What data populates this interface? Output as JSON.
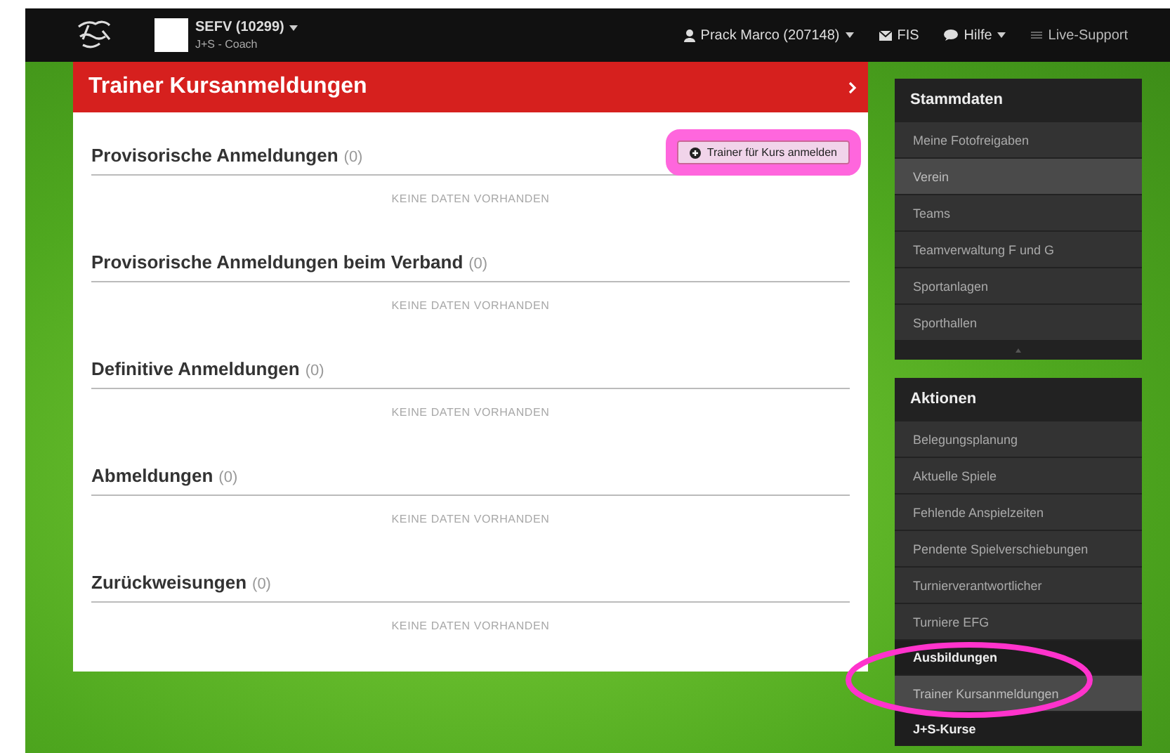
{
  "topbar": {
    "org_name": "SEFV (10299)",
    "org_role": "J+S - Coach",
    "user": "Prack Marco (207148)",
    "links": [
      {
        "kind": "mail",
        "label": "FIS",
        "dropdown": false
      },
      {
        "kind": "chat",
        "label": "Hilfe",
        "dropdown": true
      },
      {
        "kind": "support",
        "label": "Live-Support",
        "dropdown": false
      }
    ]
  },
  "panel": {
    "title": "Trainer Kursanmeldungen",
    "action_button": "Trainer für Kurs anmelden",
    "sections": [
      {
        "title": "Provisorische Anmeldungen",
        "count": "(0)",
        "empty": "KEINE DATEN VORHANDEN"
      },
      {
        "title": "Provisorische Anmeldungen beim Verband",
        "count": "(0)",
        "empty": "KEINE DATEN VORHANDEN"
      },
      {
        "title": "Definitive Anmeldungen",
        "count": "(0)",
        "empty": "KEINE DATEN VORHANDEN"
      },
      {
        "title": "Abmeldungen",
        "count": "(0)",
        "empty": "KEINE DATEN VORHANDEN"
      },
      {
        "title": "Zurückweisungen",
        "count": "(0)",
        "empty": "KEINE DATEN VORHANDEN"
      }
    ]
  },
  "sidebar": [
    {
      "title": "Stammdaten",
      "collapse_toggle": true,
      "items": [
        {
          "kind": "item",
          "label": "Meine Fotofreigaben",
          "selected": false
        },
        {
          "kind": "item",
          "label": "Verein",
          "selected": true
        },
        {
          "kind": "item",
          "label": "Teams",
          "selected": false
        },
        {
          "kind": "item",
          "label": "Teamverwaltung F und G",
          "selected": false
        },
        {
          "kind": "item",
          "label": "Sportanlagen",
          "selected": false
        },
        {
          "kind": "item",
          "label": "Sporthallen",
          "selected": false
        }
      ]
    },
    {
      "title": "Aktionen",
      "collapse_toggle": false,
      "items": [
        {
          "kind": "item",
          "label": "Belegungsplanung",
          "selected": false
        },
        {
          "kind": "item",
          "label": "Aktuelle Spiele",
          "selected": false
        },
        {
          "kind": "item",
          "label": "Fehlende Anspielzeiten",
          "selected": false
        },
        {
          "kind": "item",
          "label": "Pendente Spielverschiebungen",
          "selected": false
        },
        {
          "kind": "item",
          "label": "Turnierverantwortlicher",
          "selected": false
        },
        {
          "kind": "item",
          "label": "Turniere EFG",
          "selected": false
        },
        {
          "kind": "header",
          "label": "Ausbildungen",
          "selected": false
        },
        {
          "kind": "item",
          "label": "Trainer Kursanmeldungen",
          "selected": true
        },
        {
          "kind": "header",
          "label": "J+S-Kurse",
          "selected": false
        }
      ]
    }
  ]
}
